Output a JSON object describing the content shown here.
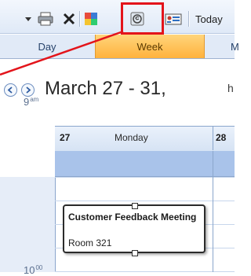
{
  "toolbar": {
    "today_label": "Today",
    "icons": [
      "dropdown-arrow-icon",
      "print-icon",
      "delete-icon",
      "categorize-icon",
      "address-book-icon",
      "business-card-icon"
    ]
  },
  "view_tabs": {
    "day": "Day",
    "week": "Week",
    "month": "M",
    "selected": "Week"
  },
  "nav": {
    "date_range": "March 27 - 31,",
    "stray_text": "h"
  },
  "calendar": {
    "days": [
      {
        "number": "27",
        "name": "Monday"
      },
      {
        "number": "28",
        "name": ""
      }
    ],
    "times": [
      {
        "hour": "9",
        "suffix": "am"
      },
      {
        "hour": "10",
        "suffix": "00"
      }
    ]
  },
  "appointment": {
    "subject": "Customer Feedback Meeting",
    "location": "Room 321"
  },
  "colors": {
    "highlight": "#e3141b",
    "selected_tab": "#ffb23d",
    "allday_band": "#a9c3ea"
  }
}
